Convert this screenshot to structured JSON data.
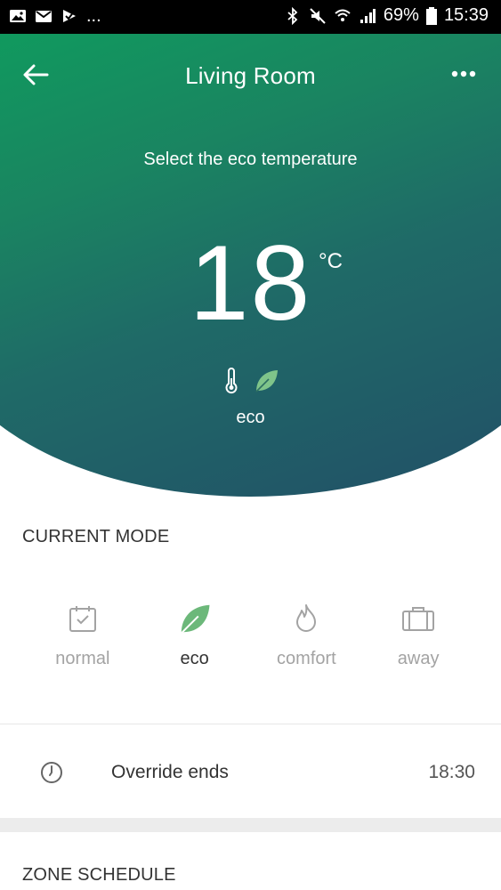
{
  "status_bar": {
    "left_icons": [
      "image-icon",
      "mail-icon",
      "checkmark-icon"
    ],
    "more": "...",
    "battery": "69%",
    "time": "15:39"
  },
  "header": {
    "title": "Living Room",
    "back_icon": "back-arrow-icon",
    "menu_icon": "more-dots-icon"
  },
  "hero": {
    "subtitle": "Select the eco temperature",
    "temperature": "18",
    "unit": "°C",
    "mode_label": "eco"
  },
  "current_mode": {
    "title": "CURRENT MODE",
    "selected": "eco",
    "modes": [
      {
        "label": "normal",
        "icon": "calendar-icon"
      },
      {
        "label": "eco",
        "icon": "leaf-icon"
      },
      {
        "label": "comfort",
        "icon": "flame-icon"
      },
      {
        "label": "away",
        "icon": "suitcase-icon"
      }
    ]
  },
  "override": {
    "label": "Override ends",
    "value": "18:30",
    "icon": "clock-icon"
  },
  "zone_schedule": {
    "title": "ZONE SCHEDULE"
  },
  "colors": {
    "gradient_top": "#0f9c5e",
    "gradient_bottom": "#224e67",
    "eco_green": "#6cb87a",
    "inactive_gray": "#a3a3a3"
  }
}
